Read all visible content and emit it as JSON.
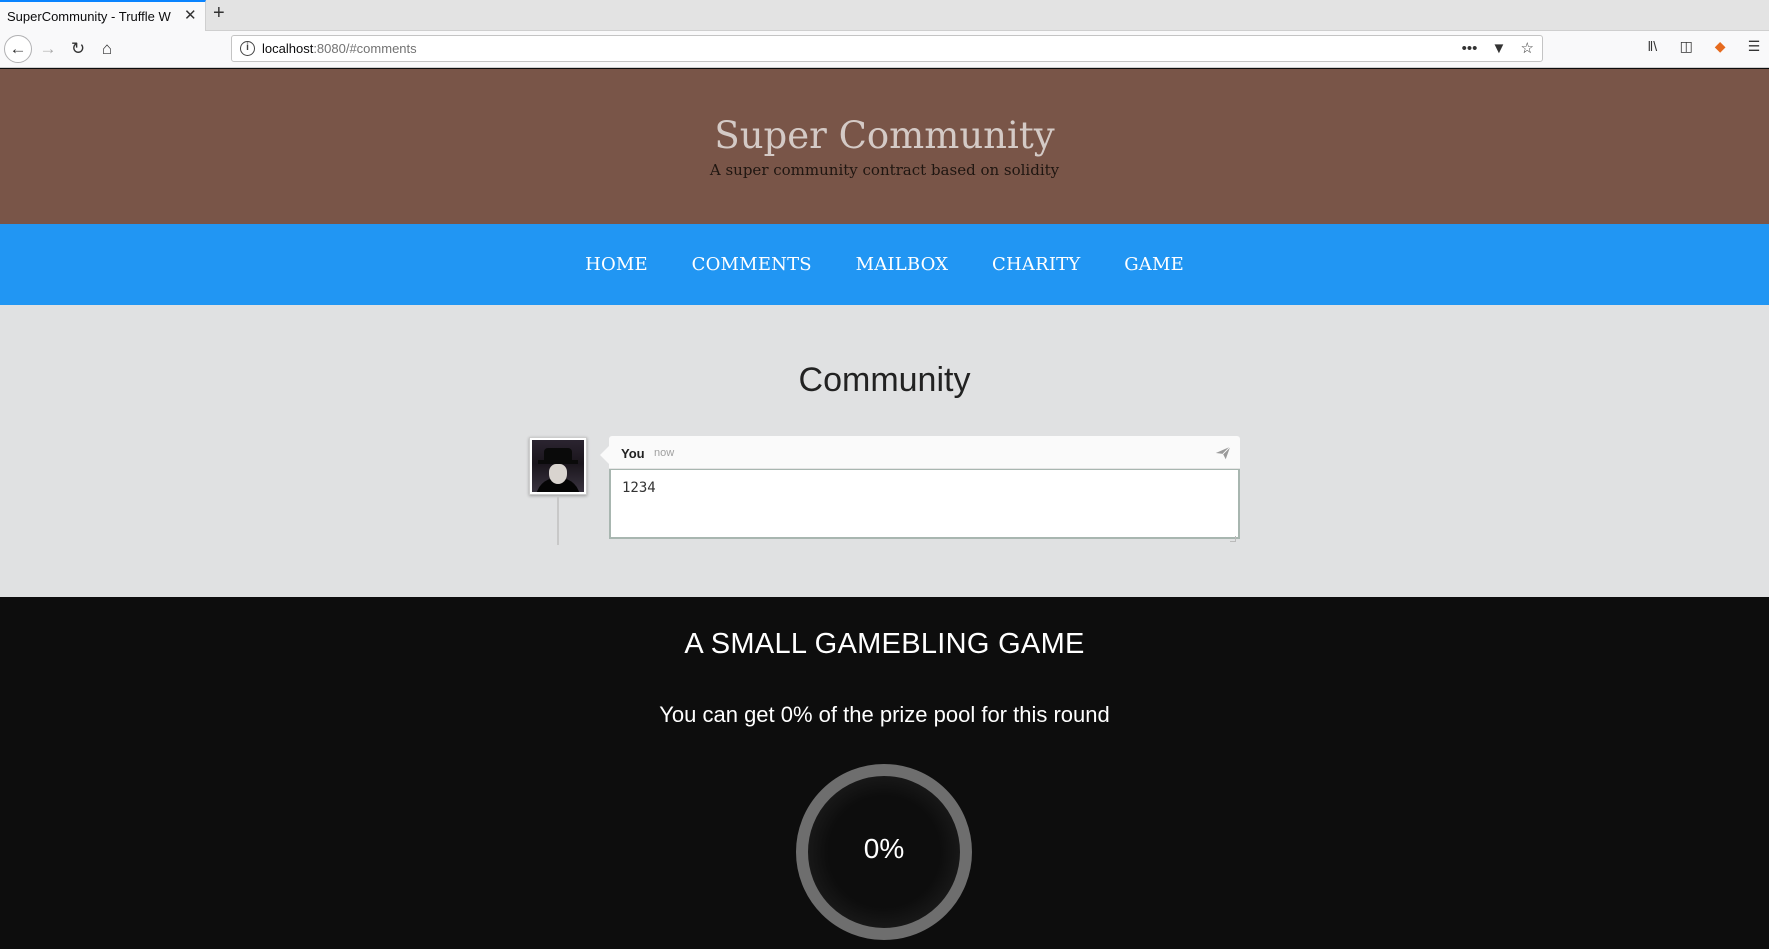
{
  "browser": {
    "tab_title": "SuperCommunity - Truffle W",
    "close_glyph": "✕",
    "newtab_glyph": "+",
    "url_host": "localhost",
    "url_rest": ":8080/#comments",
    "more_glyph": "•••"
  },
  "header": {
    "title": "Super Community",
    "subtitle": "A super community contract based on solidity",
    "background_color": "#795548"
  },
  "menu": {
    "background_color": "#2196f3",
    "items": [
      {
        "label": "HOME"
      },
      {
        "label": "COMMENTS"
      },
      {
        "label": "MAILBOX"
      },
      {
        "label": "CHARITY"
      },
      {
        "label": "GAME"
      }
    ]
  },
  "community": {
    "title": "Community",
    "comment": {
      "user": "You",
      "time": "now",
      "text": "1234"
    }
  },
  "game": {
    "title": "A SMALL GAMEBLING GAME",
    "subtitle": "You can get 0% of the prize pool for this round",
    "progress_label": "0%",
    "progress_value": 0
  }
}
